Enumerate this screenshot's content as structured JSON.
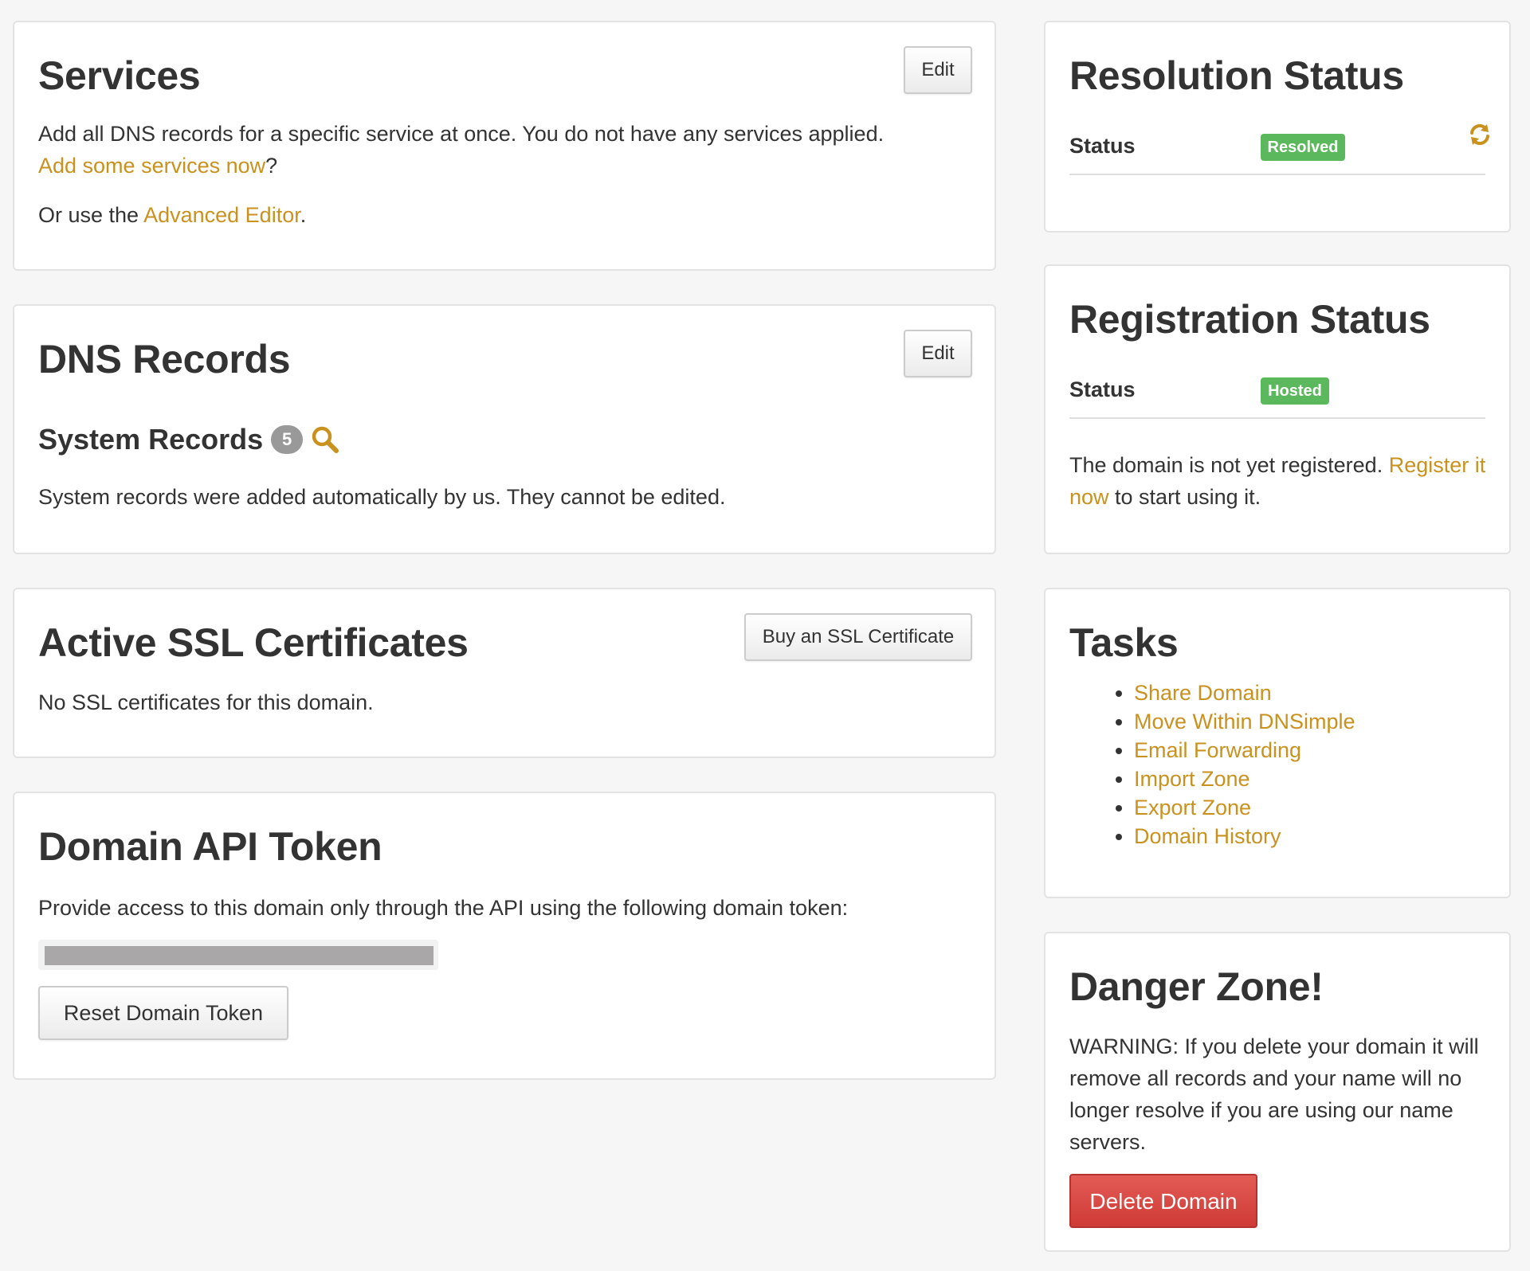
{
  "services": {
    "title": "Services",
    "edit_label": "Edit",
    "description": "Add all DNS records for a specific service at once. You do not have any services applied.",
    "add_link": "Add some services now",
    "question_mark": "?",
    "or_use": "Or use the ",
    "advanced_link": "Advanced Editor",
    "period": "."
  },
  "dns_records": {
    "title": "DNS Records",
    "edit_label": "Edit",
    "system_records_title": "System Records",
    "system_records_count": "5",
    "search_icon": "magnifier-icon",
    "system_records_description": "System records were added automatically by us. They cannot be edited."
  },
  "ssl": {
    "title": "Active SSL Certificates",
    "buy_label": "Buy an SSL Certificate",
    "empty_text": "No SSL certificates for this domain."
  },
  "api_token": {
    "title": "Domain API Token",
    "description": "Provide access to this domain only through the API using the following domain token:",
    "reset_label": "Reset Domain Token"
  },
  "resolution": {
    "title": "Resolution Status",
    "status_label": "Status",
    "status_value": "Resolved",
    "refresh_icon": "refresh-icon"
  },
  "registration": {
    "title": "Registration Status",
    "status_label": "Status",
    "status_value": "Hosted",
    "text_before": "The domain is not yet registered. ",
    "register_link": "Register it now",
    "text_after": " to start using it."
  },
  "tasks": {
    "title": "Tasks",
    "items": [
      "Share Domain",
      "Move Within DNSimple",
      "Email Forwarding",
      "Import Zone",
      "Export Zone",
      "Domain History"
    ]
  },
  "danger": {
    "title": "Danger Zone!",
    "warning": "WARNING: If you delete your domain it will remove all records and your name will no longer resolve if you are using our name servers.",
    "delete_label": "Delete Domain"
  },
  "colors": {
    "link": "#c9921f",
    "success_badge": "#5cb85c",
    "count_badge": "#999999",
    "danger_button": "#d9534f"
  }
}
